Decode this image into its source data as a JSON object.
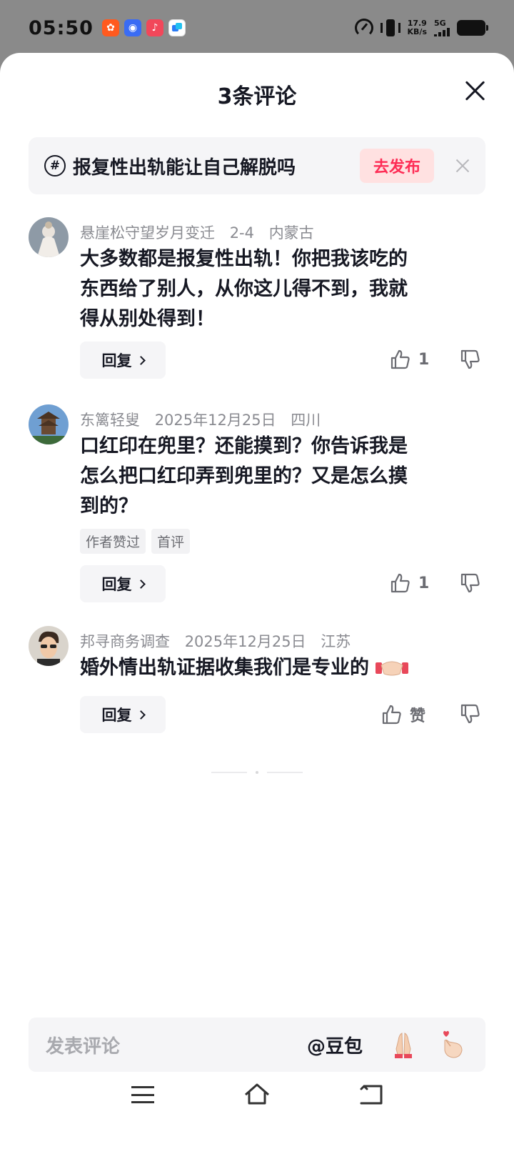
{
  "status_bar": {
    "time": "05:50",
    "net_speed_value": "17.9",
    "net_speed_unit": "KB/s",
    "network": "5G",
    "app_icons": [
      "kuaishou-icon",
      "baidu-icon",
      "douyin-icon",
      "message-app-icon"
    ]
  },
  "sheet": {
    "title": "3条评论"
  },
  "topic": {
    "text": "报复性出轨能让自己解脱吗",
    "publish_label": "去发布"
  },
  "comments": [
    {
      "username": "悬崖松守望岁月变迁",
      "date": "2-4",
      "location": "内蒙古",
      "lines": [
        "大多数都是报复性出轨！你把我该吃的",
        "东西给了别人，从你这儿得不到，我就",
        "得从别处得到！"
      ],
      "tags": [],
      "reply_label": "回复",
      "likes": "1"
    },
    {
      "username": "东篱轻叟",
      "date": "2025年12月25日",
      "location": "四川",
      "lines": [
        "口红印在兜里？还能摸到？你告诉我是",
        "怎么把口红印弄到兜里的？又是怎么摸",
        "到的？"
      ],
      "tags": [
        "作者赞过",
        "首评"
      ],
      "reply_label": "回复",
      "likes": "1"
    },
    {
      "username": "邦寻商务调查",
      "date": "2025年12月25日",
      "location": "江苏",
      "lines": [
        "婚外情出轨证据收集我们是专业的"
      ],
      "tags": [],
      "reply_label": "回复",
      "likes": "赞"
    }
  ],
  "input_bar": {
    "placeholder": "发表评论",
    "mention": "@豆包",
    "emoji_1": "🙏",
    "emoji_2": "🫰"
  },
  "colors": {
    "accent": "#fe2c55",
    "publish_bg": "#ffe1e1",
    "text_primary": "#161823",
    "text_secondary": "#8a8b91"
  }
}
